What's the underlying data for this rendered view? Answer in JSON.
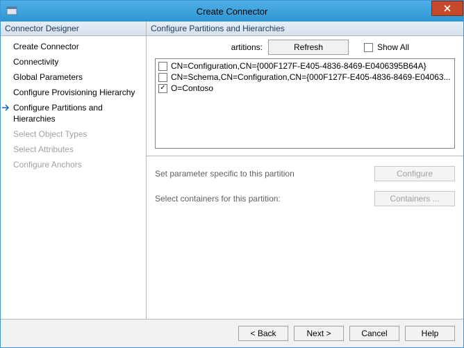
{
  "window": {
    "title": "Create Connector"
  },
  "left": {
    "header": "Connector Designer",
    "items": [
      {
        "label": "Create Connector",
        "state": "done"
      },
      {
        "label": "Connectivity",
        "state": "done"
      },
      {
        "label": "Global Parameters",
        "state": "done"
      },
      {
        "label": "Configure Provisioning Hierarchy",
        "state": "done"
      },
      {
        "label": "Configure Partitions and Hierarchies",
        "state": "current"
      },
      {
        "label": "Select Object Types",
        "state": "pending"
      },
      {
        "label": "Select Attributes",
        "state": "pending"
      },
      {
        "label": "Configure Anchors",
        "state": "pending"
      }
    ]
  },
  "right": {
    "header": "Configure Partitions and Hierarchies",
    "partitions_label": "artitions:",
    "refresh": "Refresh",
    "showall_label": "Show All",
    "showall_checked": false,
    "list": [
      {
        "label": "CN=Configuration,CN={000F127F-E405-4836-8469-E0406395B64A}",
        "checked": false
      },
      {
        "label": "CN=Schema,CN=Configuration,CN={000F127F-E405-4836-8469-E04063...",
        "checked": false
      },
      {
        "label": "O=Contoso",
        "checked": true
      }
    ],
    "param_label": "Set parameter specific to this partition",
    "configure_btn": "Configure",
    "containers_label": "Select containers for this partition:",
    "containers_btn": "Containers ..."
  },
  "buttons": {
    "back": "<  Back",
    "next": "Next  >",
    "cancel": "Cancel",
    "help": "Help"
  }
}
